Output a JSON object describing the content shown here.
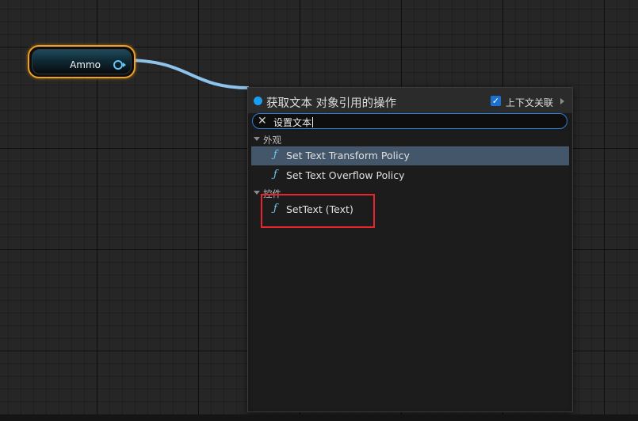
{
  "graph": {
    "node": {
      "label": "Ammo",
      "pin_icon": "output-pin-icon"
    },
    "colors": {
      "node_border": "#f0a020",
      "pin": "#62c6f2",
      "wire": "#8ec3eb",
      "selection": "#44566a"
    }
  },
  "menu": {
    "title": "获取文本 对象引用的操作",
    "context_sensitive": {
      "label": "上下文关联",
      "checked": true
    },
    "search": {
      "value": "设置文本"
    },
    "categories": [
      {
        "label": "外观",
        "items": [
          {
            "label": "Set Text Transform Policy",
            "icon": "function-icon",
            "selected": true
          },
          {
            "label": "Set Text Overflow Policy",
            "icon": "function-icon",
            "selected": false
          }
        ]
      },
      {
        "label": "控件",
        "items": [
          {
            "label": "SetText (Text)",
            "icon": "function-icon",
            "selected": false
          }
        ]
      }
    ]
  }
}
